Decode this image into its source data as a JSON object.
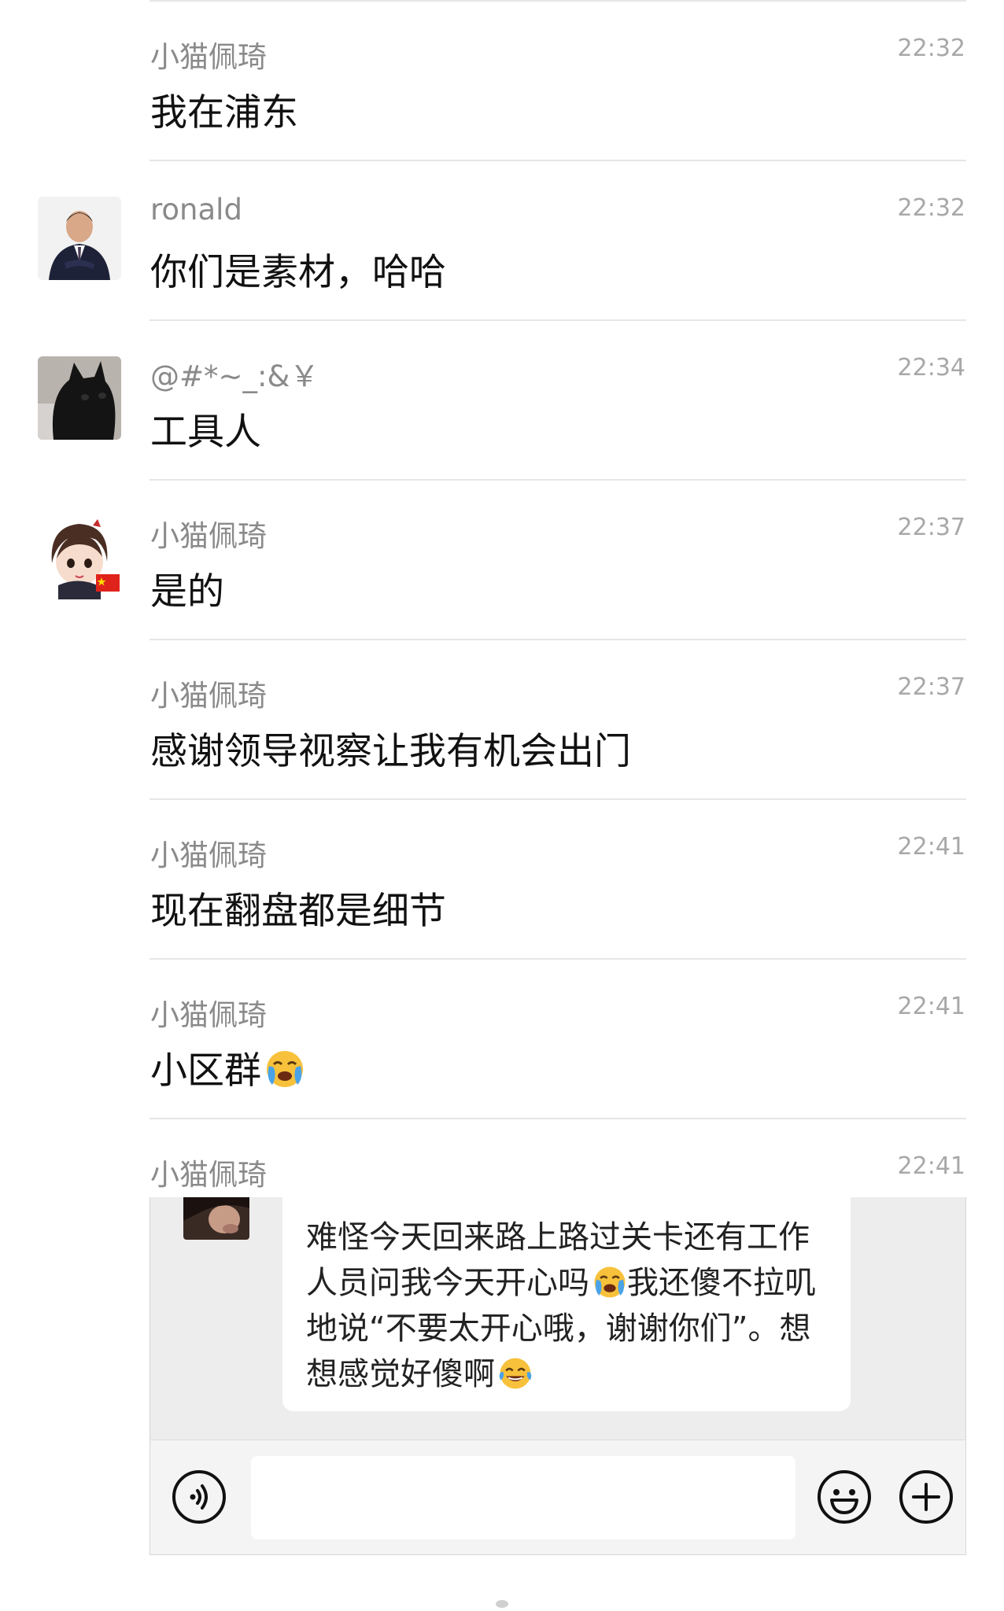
{
  "messages": [
    {
      "name": "小猫佩琦",
      "time": "22:32",
      "text": "我在浦东",
      "emoji": null
    },
    {
      "name": "ronald",
      "time": "22:32",
      "text": "你们是素材，哈哈",
      "emoji": null
    },
    {
      "name": "@#*~_:&￥",
      "time": "22:34",
      "text": "工具人",
      "emoji": null
    },
    {
      "name": "小猫佩琦",
      "time": "22:37",
      "text": "是的",
      "emoji": null
    },
    {
      "name": "小猫佩琦",
      "time": "22:37",
      "text": "感谢领导视察让我有机会出门",
      "emoji": null
    },
    {
      "name": "小猫佩琦",
      "time": "22:41",
      "text": "现在翻盘都是细节",
      "emoji": null
    },
    {
      "name": "小猫佩琦",
      "time": "22:41",
      "text": "小区群",
      "emoji": "loudly-crying-face"
    },
    {
      "name": "小猫佩琦",
      "time": "22:41",
      "text": "",
      "emoji": null
    }
  ],
  "quoted": {
    "part1": "难怪今天回来路上路过关卡还有工作人员问我今天开心吗",
    "emoji1": "loudly-crying-face",
    "part2": "我还傻不拉叽地说“不要太开心哦，谢谢你们”。想想感觉好傻啊",
    "emoji2": "tears-of-joy-face"
  },
  "input": {
    "placeholder": "",
    "value": ""
  },
  "icons": {
    "voice": "voice-icon",
    "emoji": "emoji-icon",
    "plus": "plus-icon"
  }
}
